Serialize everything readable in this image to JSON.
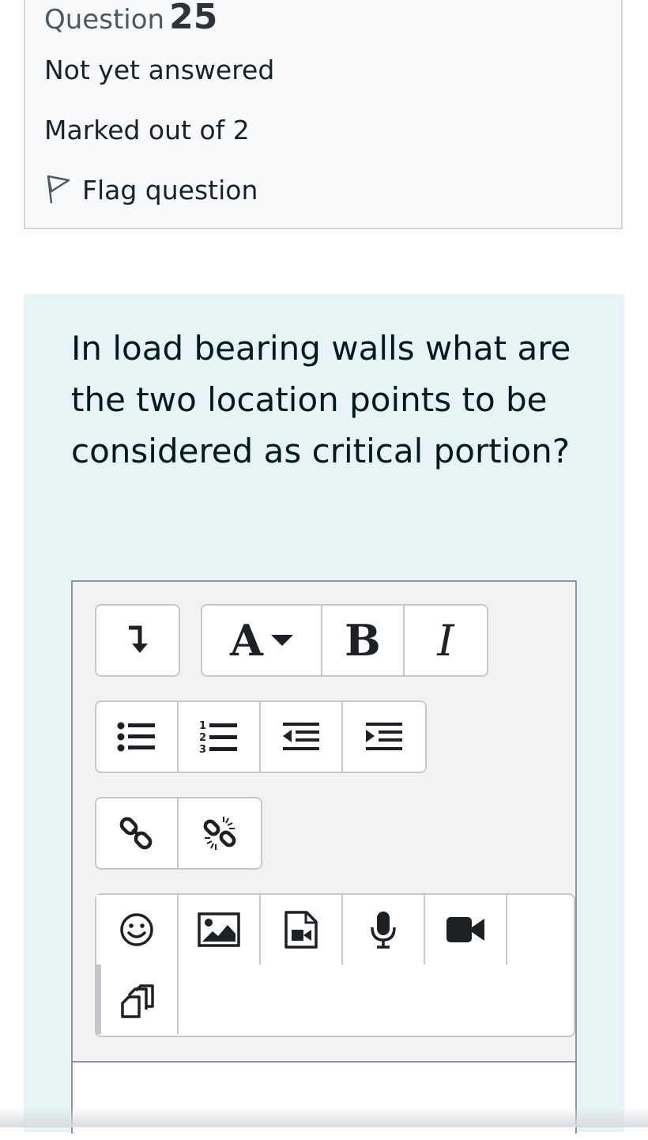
{
  "question_info": {
    "label": "Question",
    "number": "25",
    "state": "Not yet answered",
    "grade": "Marked out of 2",
    "flag_label": "Flag question"
  },
  "question_text": "In load bearing walls what are the two location points to be considered as critical portion?",
  "editor": {
    "toolbar": {
      "font_button_label": "A",
      "bold_label": "B",
      "italic_label": "I",
      "icons": [
        "collapse-icon",
        "font-size-icon",
        "bold-icon",
        "italic-icon",
        "unordered-list-icon",
        "ordered-list-icon",
        "outdent-icon",
        "indent-icon",
        "link-icon",
        "unlink-icon",
        "emoji-icon",
        "image-icon",
        "media-icon",
        "record-audio-icon",
        "record-video-icon",
        "manage-files-icon"
      ]
    }
  },
  "colors": {
    "info_bg": "#f8f9fa",
    "formulation_bg": "#e7f3f5",
    "editor_bg": "#f2f2f2",
    "border": "#8f959e"
  }
}
